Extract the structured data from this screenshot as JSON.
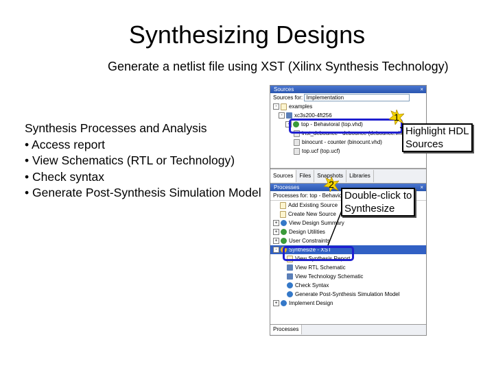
{
  "slide": {
    "title": "Synthesizing Designs",
    "subtitle": "Generate a netlist file using XST (Xilinx Synthesis Technology)",
    "section_heading": "Synthesis Processes and Analysis",
    "bullets": [
      "• Access report",
      "• View Schematics (RTL or Technology)",
      "• Check syntax",
      "• Generate Post-Synthesis Simulation Model"
    ]
  },
  "callouts": {
    "step1": {
      "number": "1",
      "line1": "Highlight HDL",
      "line2": "Sources"
    },
    "step2": {
      "number": "2",
      "line1": "Double-click to",
      "line2": "Synthesize"
    }
  },
  "sources_pane": {
    "title": "Sources",
    "close": "×",
    "sources_for_label": "Sources for:",
    "sources_for_value": "Implementation",
    "items": [
      "examples",
      "xc3s200-4ft256",
      "top - Behavioral (top.vhd)",
      "inst_debounce - debounce (debounce.vhd)",
      "binocunt - counter (binocunt.vhd)",
      "top.ucf (top.ucf)"
    ],
    "tabs": [
      "Sources",
      "Files",
      "Snapshots",
      "Libraries"
    ]
  },
  "processes_pane": {
    "title": "Processes",
    "close": "×",
    "header": "Processes for: top - Behavioral",
    "items": [
      "Add Existing Source",
      "Create New Source",
      "View Design Summary",
      "Design Utilities",
      "User Constraints",
      "Synthesize - XST",
      "View Synthesis Report",
      "View RTL Schematic",
      "View Technology Schematic",
      "Check Syntax",
      "Generate Post-Synthesis Simulation Model",
      "Implement Design"
    ],
    "bottom_tab": "Processes"
  }
}
